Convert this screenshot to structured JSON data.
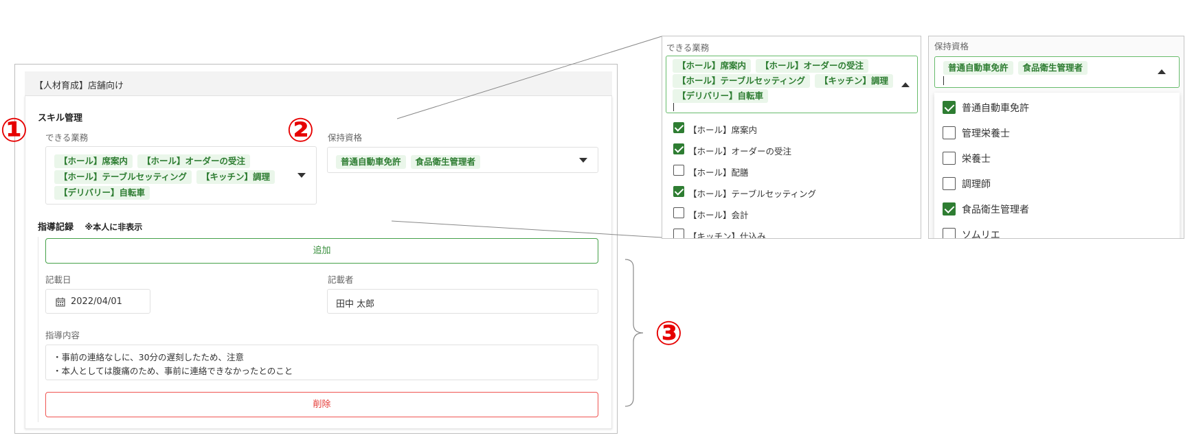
{
  "main": {
    "header_title": "【人材育成】店舗向け",
    "skill_section": {
      "title": "スキル管理",
      "duties_label": "できる業務",
      "duties_chips": [
        "【ホール】席案内",
        "【ホール】オーダーの受注",
        "【ホール】テーブルセッティング",
        "【キッチン】調理",
        "【デリバリー】自転車"
      ],
      "qualifications_label": "保持資格",
      "qualification_chips": [
        "普通自動車免許",
        "食品衛生管理者"
      ]
    },
    "guidance_section": {
      "title": "指導記録",
      "note": "※本人に非表示",
      "add_label": "追加",
      "date_label": "記載日",
      "date_value": "2022/04/01",
      "author_label": "記載者",
      "author_value": "田中 太郎",
      "content_label": "指導内容",
      "content_lines": [
        "・事前の連絡なしに、30分の遅刻したため、注意",
        "・本人としては腹痛のため、事前に連絡できなかったとのこと"
      ],
      "delete_label": "削除"
    }
  },
  "annotations": {
    "one": "①",
    "two": "②",
    "three": "③"
  },
  "zoom_duties": {
    "label": "できる業務",
    "chips": [
      "【ホール】席案内",
      "【ホール】オーダーの受注",
      "【ホール】テーブルセッティング",
      "【キッチン】調理",
      "【デリバリー】自転車"
    ],
    "options": [
      {
        "label": "【ホール】席案内",
        "checked": true
      },
      {
        "label": "【ホール】オーダーの受注",
        "checked": true
      },
      {
        "label": "【ホール】配膳",
        "checked": false
      },
      {
        "label": "【ホール】テーブルセッティング",
        "checked": true
      },
      {
        "label": "【ホール】会計",
        "checked": false
      },
      {
        "label": "【キッチン】仕込み",
        "checked": false
      }
    ]
  },
  "zoom_qualifications": {
    "label": "保持資格",
    "chips": [
      "普通自動車免許",
      "食品衛生管理者"
    ],
    "options": [
      {
        "label": "普通自動車免許",
        "checked": true
      },
      {
        "label": "管理栄養士",
        "checked": false
      },
      {
        "label": "栄養士",
        "checked": false
      },
      {
        "label": "調理師",
        "checked": false
      },
      {
        "label": "食品衛生管理者",
        "checked": true
      },
      {
        "label": "ソムリエ",
        "checked": false
      }
    ]
  },
  "colors": {
    "chip_bg": "#eaf6ea",
    "chip_text": "#2e7d32",
    "annotation_red": "#e60000",
    "add_button_green": "#43a047",
    "delete_button_red": "#ef5350",
    "checkbox_checked": "#2e7d32"
  },
  "icons": {
    "calendar": "calendar-icon",
    "caret_down": "chevron-down-icon",
    "caret_up": "chevron-up-icon",
    "brace": "curly-brace-icon"
  }
}
